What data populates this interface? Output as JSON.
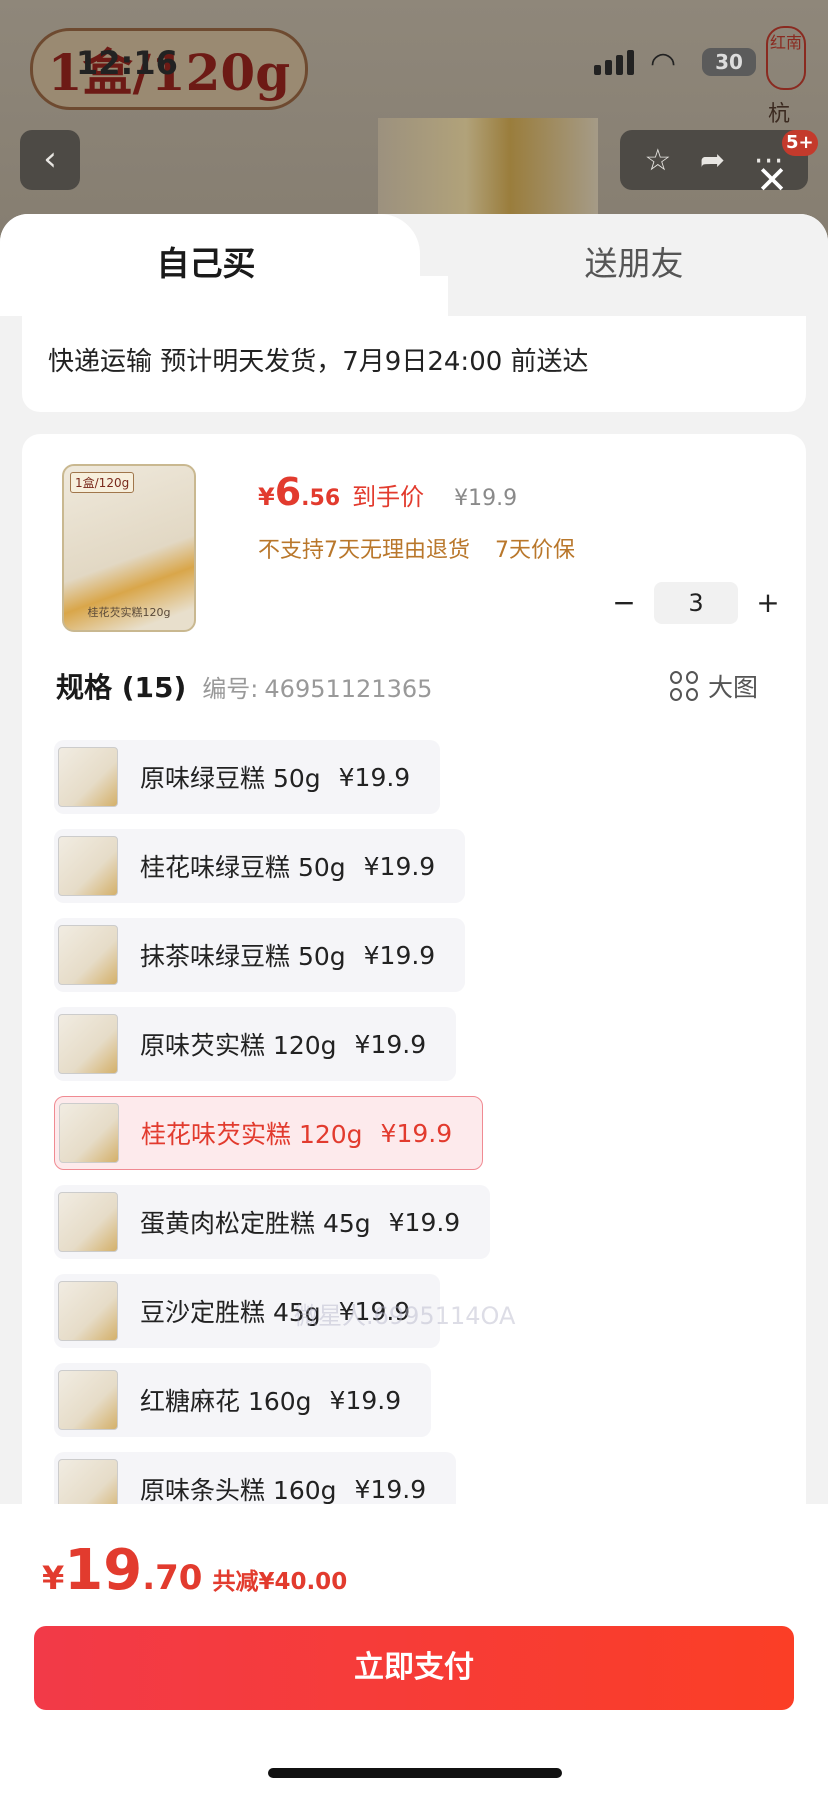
{
  "status_bar": {
    "time": "12:16",
    "battery": "30"
  },
  "background": {
    "banner_text": "1盒/120g",
    "side_text": "杭州特",
    "seal_text": "红南",
    "cart_badge": "5+"
  },
  "tabs": [
    {
      "label": "自己买",
      "active": true
    },
    {
      "label": "送朋友",
      "active": false
    }
  ],
  "delivery": {
    "text": "快递运输 预计明天发货，7月9日24:00 前送达"
  },
  "product": {
    "thumb_tag": "1盒/120g",
    "thumb_caption": "桂花芡实糕120g",
    "currency": "¥",
    "price_int": "6",
    "price_dec": ".56",
    "price_label": "到手价",
    "original_price": "¥19.9",
    "policies": [
      "不支持7天无理由退货",
      "7天价保"
    ],
    "quantity": "3",
    "qty_minus": "−",
    "qty_plus": "+"
  },
  "spec": {
    "title": "规格 (15)",
    "code_label": "编号:",
    "code": "46951121365",
    "big_picture_label": "大图",
    "watermark": "微星人.6995114OA",
    "items": [
      {
        "name": "原味绿豆糕 50g",
        "price": "¥19.9",
        "selected": false
      },
      {
        "name": "桂花味绿豆糕 50g",
        "price": "¥19.9",
        "selected": false
      },
      {
        "name": "抹茶味绿豆糕 50g",
        "price": "¥19.9",
        "selected": false
      },
      {
        "name": "原味芡实糕 120g",
        "price": "¥19.9",
        "selected": false
      },
      {
        "name": "桂花味芡实糕 120g",
        "price": "¥19.9",
        "selected": true
      },
      {
        "name": "蛋黄肉松定胜糕 45g",
        "price": "¥19.9",
        "selected": false
      },
      {
        "name": "豆沙定胜糕 45g",
        "price": "¥19.9",
        "selected": false
      },
      {
        "name": "红糖麻花 160g",
        "price": "¥19.9",
        "selected": false
      },
      {
        "name": "原味条头糕 160g",
        "price": "¥19.9",
        "selected": false
      }
    ]
  },
  "footer": {
    "currency": "¥",
    "total_int": "19",
    "total_dec": ".70",
    "discount": "共减¥40.00",
    "pay_label": "立即支付"
  },
  "colors": {
    "accent_red": "#e23b2e",
    "policy_orange": "#b9772b",
    "selected_bg": "#fdeaec"
  }
}
